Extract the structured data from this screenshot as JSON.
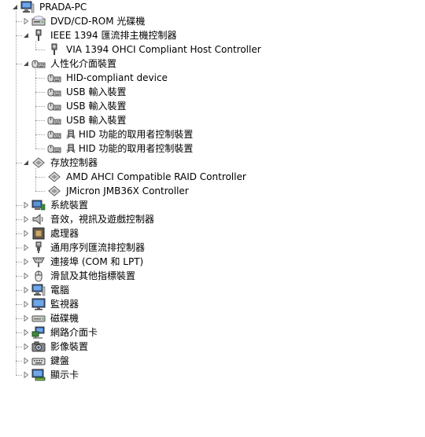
{
  "root": {
    "label": "PRADA-PC",
    "icon": "computer-icon"
  },
  "categories": [
    {
      "label": "DVD/CD-ROM 光碟機",
      "icon": "optical-drive-icon",
      "expanded": false,
      "children": []
    },
    {
      "label": "IEEE 1394 匯流排主機控制器",
      "icon": "ieee1394-icon",
      "expanded": true,
      "children": [
        {
          "label": "VIA 1394 OHCI Compliant Host Controller",
          "icon": "ieee1394-icon"
        }
      ]
    },
    {
      "label": "人性化介面裝置",
      "icon": "hid-icon",
      "expanded": true,
      "children": [
        {
          "label": "HID-compliant device",
          "icon": "hid-icon"
        },
        {
          "label": "USB 輸入裝置",
          "icon": "hid-icon"
        },
        {
          "label": "USB 輸入裝置",
          "icon": "hid-icon"
        },
        {
          "label": "USB 輸入裝置",
          "icon": "hid-icon"
        },
        {
          "label": "具 HID 功能的取用者控制裝置",
          "icon": "hid-icon"
        },
        {
          "label": "具 HID 功能的取用者控制裝置",
          "icon": "hid-icon"
        }
      ]
    },
    {
      "label": "存放控制器",
      "icon": "storage-controller-icon",
      "expanded": true,
      "children": [
        {
          "label": "AMD AHCI Compatible RAID Controller",
          "icon": "storage-controller-icon"
        },
        {
          "label": "JMicron JMB36X Controller",
          "icon": "storage-controller-icon"
        }
      ]
    },
    {
      "label": "系統裝置",
      "icon": "system-device-icon",
      "expanded": false,
      "children": []
    },
    {
      "label": "音效，視訊及遊戲控制器",
      "icon": "speaker-icon",
      "expanded": false,
      "children": []
    },
    {
      "label": "處理器",
      "icon": "processor-icon",
      "expanded": false,
      "children": []
    },
    {
      "label": "通用序列匯流排控制器",
      "icon": "usb-icon",
      "expanded": false,
      "children": []
    },
    {
      "label": "連接埠 (COM 和 LPT)",
      "icon": "port-icon",
      "expanded": false,
      "children": []
    },
    {
      "label": "滑鼠及其他指標裝置",
      "icon": "mouse-icon",
      "expanded": false,
      "children": []
    },
    {
      "label": "電腦",
      "icon": "computer-icon",
      "expanded": false,
      "children": []
    },
    {
      "label": "監視器",
      "icon": "monitor-icon",
      "expanded": false,
      "children": []
    },
    {
      "label": "磁碟機",
      "icon": "disk-drive-icon",
      "expanded": false,
      "children": []
    },
    {
      "label": "網路介面卡",
      "icon": "network-adapter-icon",
      "expanded": false,
      "children": []
    },
    {
      "label": "影像裝置",
      "icon": "imaging-device-icon",
      "expanded": false,
      "children": []
    },
    {
      "label": "鍵盤",
      "icon": "keyboard-icon",
      "expanded": false,
      "children": []
    },
    {
      "label": "顯示卡",
      "icon": "display-adapter-icon",
      "expanded": false,
      "children": []
    }
  ]
}
